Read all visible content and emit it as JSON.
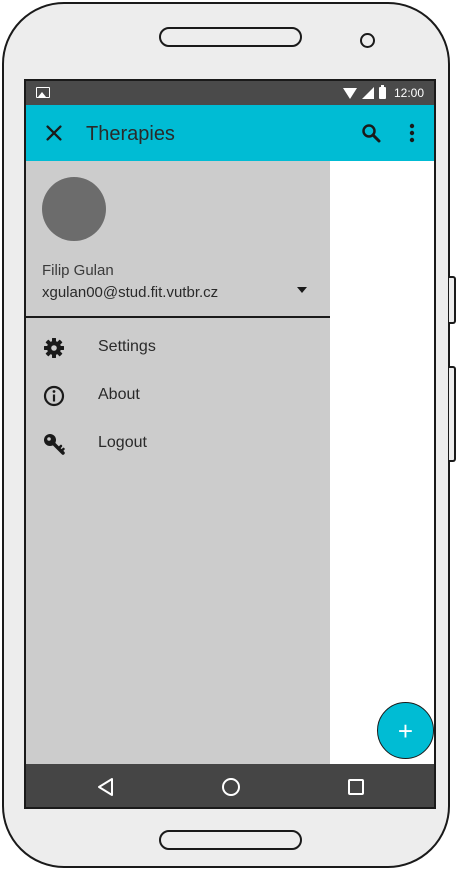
{
  "status_bar": {
    "time": "12:00",
    "icons": [
      "image-icon",
      "wifi-icon",
      "signal-icon",
      "battery-icon"
    ]
  },
  "app_bar": {
    "title": "Therapies",
    "close_icon": "close-icon",
    "search_icon": "search-icon",
    "more_icon": "more-vert-icon",
    "background_color": "#00bcd4"
  },
  "drawer": {
    "user": {
      "name": "Filip Gulan",
      "email": "xgulan00@stud.fit.vutbr.cz"
    },
    "items": [
      {
        "label": "Settings",
        "icon": "gear-icon"
      },
      {
        "label": "About",
        "icon": "info-icon"
      },
      {
        "label": "Logout",
        "icon": "key-icon"
      }
    ],
    "background_color": "#cccccc"
  },
  "fab": {
    "label": "+",
    "icon": "plus-icon",
    "color": "#00bcd4"
  },
  "nav_bar": {
    "buttons": [
      "back-icon",
      "home-icon",
      "recents-icon"
    ]
  }
}
